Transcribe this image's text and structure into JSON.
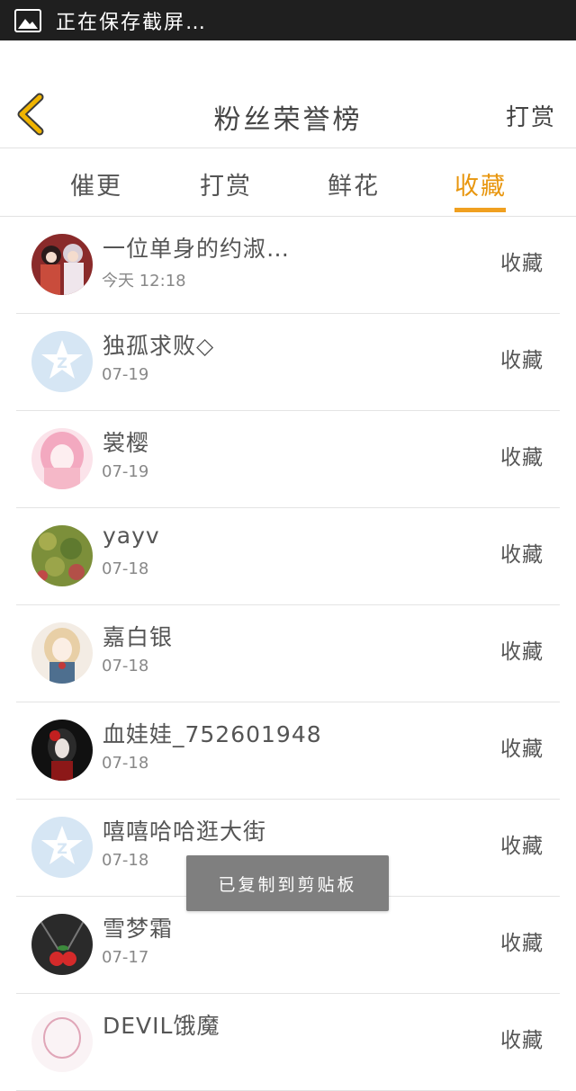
{
  "status_bar": {
    "icon": "image-icon",
    "text": "正在保存截屏…"
  },
  "nav": {
    "title": "粉丝荣誉榜",
    "right_label": "打赏",
    "back_icon": "chevron-left-icon",
    "accent": "#f0b400"
  },
  "tabs": [
    {
      "label": "催更",
      "active": false
    },
    {
      "label": "打赏",
      "active": false
    },
    {
      "label": "鲜花",
      "active": false
    },
    {
      "label": "收藏",
      "active": true
    }
  ],
  "accent_color": "#f0a020",
  "fans": [
    {
      "name": "一位单身的约淑…",
      "date": "今天 12:18",
      "action": "收藏",
      "avatar": "anime-avatar"
    },
    {
      "name": "独孤求败◇",
      "date": "07-19",
      "action": "收藏",
      "avatar": "default-qzone-avatar"
    },
    {
      "name": "裳樱",
      "date": "07-19",
      "action": "收藏",
      "avatar": "pink-anime-avatar"
    },
    {
      "name": "yayv",
      "date": "07-18",
      "action": "收藏",
      "avatar": "green-texture-avatar"
    },
    {
      "name": "嘉白银",
      "date": "07-18",
      "action": "收藏",
      "avatar": "anime-girl-avatar"
    },
    {
      "name": "血娃娃_752601948",
      "date": "07-18",
      "action": "收藏",
      "avatar": "dark-doll-avatar"
    },
    {
      "name": "嘻嘻哈哈逛大街",
      "date": "07-18",
      "action": "收藏",
      "avatar": "default-qzone-avatar"
    },
    {
      "name": "雪梦霜",
      "date": "07-17",
      "action": "收藏",
      "avatar": "cherry-avatar"
    },
    {
      "name": "DEVIL饿魔",
      "date": "",
      "action": "收藏",
      "avatar": "sketch-avatar"
    }
  ],
  "toast": {
    "text": "已复制到剪贴板"
  }
}
